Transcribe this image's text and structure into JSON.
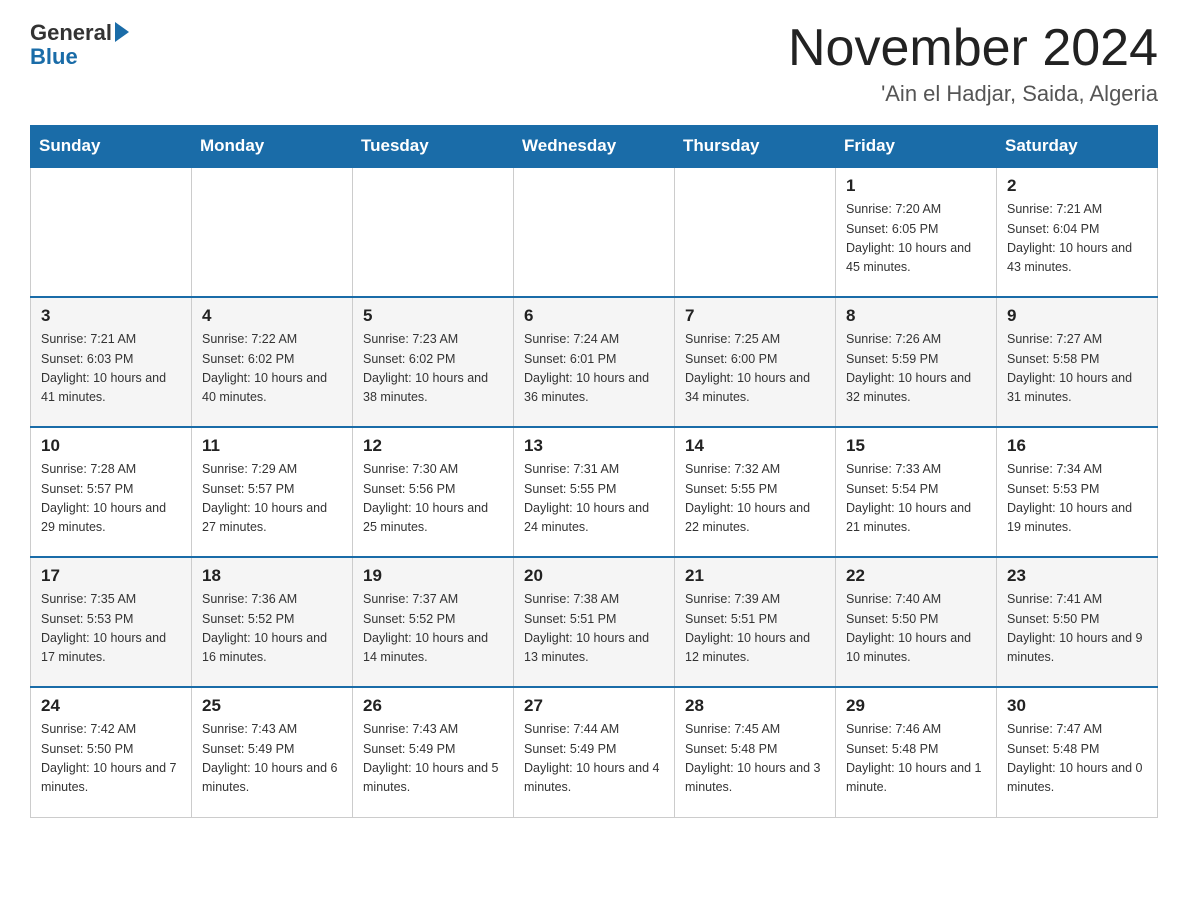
{
  "header": {
    "logo_text": "General",
    "logo_blue": "Blue",
    "month_title": "November 2024",
    "location": "'Ain el Hadjar, Saida, Algeria"
  },
  "weekdays": [
    "Sunday",
    "Monday",
    "Tuesday",
    "Wednesday",
    "Thursday",
    "Friday",
    "Saturday"
  ],
  "rows": [
    [
      {
        "day": "",
        "info": ""
      },
      {
        "day": "",
        "info": ""
      },
      {
        "day": "",
        "info": ""
      },
      {
        "day": "",
        "info": ""
      },
      {
        "day": "",
        "info": ""
      },
      {
        "day": "1",
        "info": "Sunrise: 7:20 AM\nSunset: 6:05 PM\nDaylight: 10 hours and 45 minutes."
      },
      {
        "day": "2",
        "info": "Sunrise: 7:21 AM\nSunset: 6:04 PM\nDaylight: 10 hours and 43 minutes."
      }
    ],
    [
      {
        "day": "3",
        "info": "Sunrise: 7:21 AM\nSunset: 6:03 PM\nDaylight: 10 hours and 41 minutes."
      },
      {
        "day": "4",
        "info": "Sunrise: 7:22 AM\nSunset: 6:02 PM\nDaylight: 10 hours and 40 minutes."
      },
      {
        "day": "5",
        "info": "Sunrise: 7:23 AM\nSunset: 6:02 PM\nDaylight: 10 hours and 38 minutes."
      },
      {
        "day": "6",
        "info": "Sunrise: 7:24 AM\nSunset: 6:01 PM\nDaylight: 10 hours and 36 minutes."
      },
      {
        "day": "7",
        "info": "Sunrise: 7:25 AM\nSunset: 6:00 PM\nDaylight: 10 hours and 34 minutes."
      },
      {
        "day": "8",
        "info": "Sunrise: 7:26 AM\nSunset: 5:59 PM\nDaylight: 10 hours and 32 minutes."
      },
      {
        "day": "9",
        "info": "Sunrise: 7:27 AM\nSunset: 5:58 PM\nDaylight: 10 hours and 31 minutes."
      }
    ],
    [
      {
        "day": "10",
        "info": "Sunrise: 7:28 AM\nSunset: 5:57 PM\nDaylight: 10 hours and 29 minutes."
      },
      {
        "day": "11",
        "info": "Sunrise: 7:29 AM\nSunset: 5:57 PM\nDaylight: 10 hours and 27 minutes."
      },
      {
        "day": "12",
        "info": "Sunrise: 7:30 AM\nSunset: 5:56 PM\nDaylight: 10 hours and 25 minutes."
      },
      {
        "day": "13",
        "info": "Sunrise: 7:31 AM\nSunset: 5:55 PM\nDaylight: 10 hours and 24 minutes."
      },
      {
        "day": "14",
        "info": "Sunrise: 7:32 AM\nSunset: 5:55 PM\nDaylight: 10 hours and 22 minutes."
      },
      {
        "day": "15",
        "info": "Sunrise: 7:33 AM\nSunset: 5:54 PM\nDaylight: 10 hours and 21 minutes."
      },
      {
        "day": "16",
        "info": "Sunrise: 7:34 AM\nSunset: 5:53 PM\nDaylight: 10 hours and 19 minutes."
      }
    ],
    [
      {
        "day": "17",
        "info": "Sunrise: 7:35 AM\nSunset: 5:53 PM\nDaylight: 10 hours and 17 minutes."
      },
      {
        "day": "18",
        "info": "Sunrise: 7:36 AM\nSunset: 5:52 PM\nDaylight: 10 hours and 16 minutes."
      },
      {
        "day": "19",
        "info": "Sunrise: 7:37 AM\nSunset: 5:52 PM\nDaylight: 10 hours and 14 minutes."
      },
      {
        "day": "20",
        "info": "Sunrise: 7:38 AM\nSunset: 5:51 PM\nDaylight: 10 hours and 13 minutes."
      },
      {
        "day": "21",
        "info": "Sunrise: 7:39 AM\nSunset: 5:51 PM\nDaylight: 10 hours and 12 minutes."
      },
      {
        "day": "22",
        "info": "Sunrise: 7:40 AM\nSunset: 5:50 PM\nDaylight: 10 hours and 10 minutes."
      },
      {
        "day": "23",
        "info": "Sunrise: 7:41 AM\nSunset: 5:50 PM\nDaylight: 10 hours and 9 minutes."
      }
    ],
    [
      {
        "day": "24",
        "info": "Sunrise: 7:42 AM\nSunset: 5:50 PM\nDaylight: 10 hours and 7 minutes."
      },
      {
        "day": "25",
        "info": "Sunrise: 7:43 AM\nSunset: 5:49 PM\nDaylight: 10 hours and 6 minutes."
      },
      {
        "day": "26",
        "info": "Sunrise: 7:43 AM\nSunset: 5:49 PM\nDaylight: 10 hours and 5 minutes."
      },
      {
        "day": "27",
        "info": "Sunrise: 7:44 AM\nSunset: 5:49 PM\nDaylight: 10 hours and 4 minutes."
      },
      {
        "day": "28",
        "info": "Sunrise: 7:45 AM\nSunset: 5:48 PM\nDaylight: 10 hours and 3 minutes."
      },
      {
        "day": "29",
        "info": "Sunrise: 7:46 AM\nSunset: 5:48 PM\nDaylight: 10 hours and 1 minute."
      },
      {
        "day": "30",
        "info": "Sunrise: 7:47 AM\nSunset: 5:48 PM\nDaylight: 10 hours and 0 minutes."
      }
    ]
  ]
}
